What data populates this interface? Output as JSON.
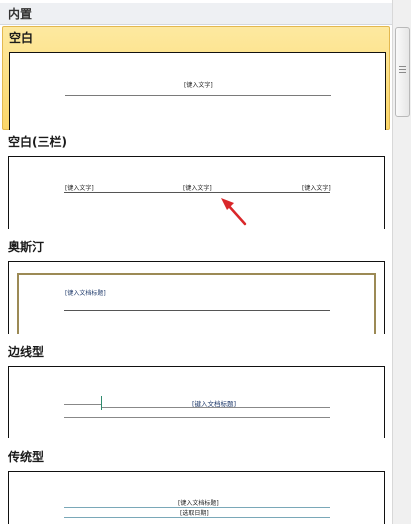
{
  "gallery": {
    "group_title": "内置",
    "items": [
      {
        "title": "空白",
        "placeholders": [
          "[键入文字]"
        ]
      },
      {
        "title": "空白(三栏)",
        "placeholders": [
          "[键入文字]",
          "[键入文字]",
          "[键入文字]"
        ]
      },
      {
        "title": "奥斯汀",
        "placeholders": [
          "[键入文档标题]"
        ]
      },
      {
        "title": "边线型",
        "placeholders": [
          "[键入文档标题]"
        ]
      },
      {
        "title": "传统型",
        "placeholders": [
          "[键入文档标题]",
          "[选取日期]"
        ]
      }
    ]
  },
  "colors": {
    "selected_bg": "#fcd76a",
    "annotation_arrow": "#d9272a",
    "austin_border": "#9c8a55",
    "sideline_accent": "#2e8b6e",
    "title_text": "#1f3a6b"
  }
}
